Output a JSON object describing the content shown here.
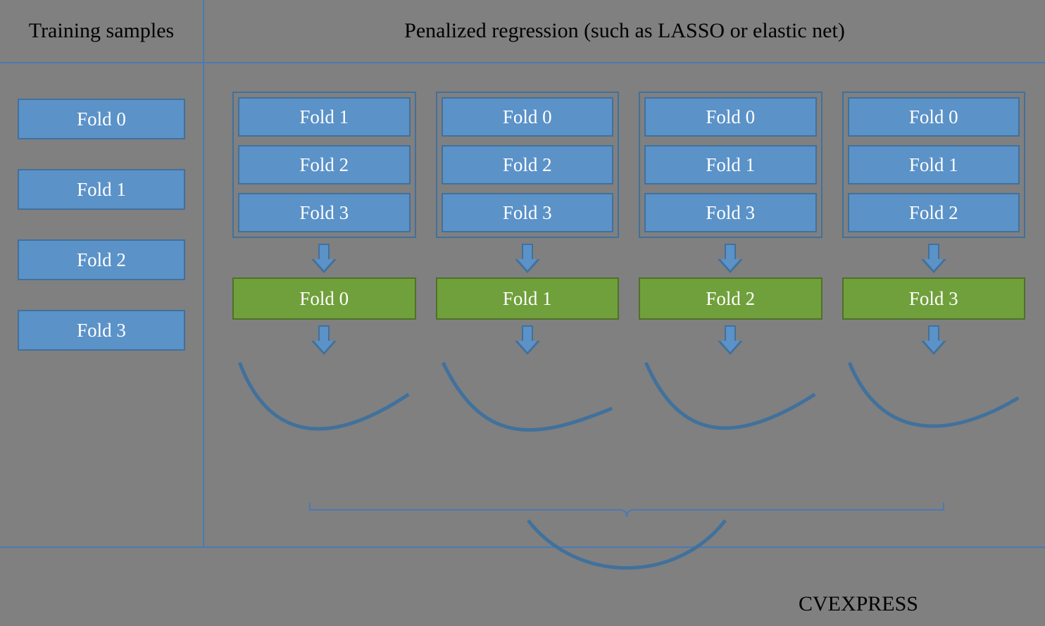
{
  "header": {
    "left": "Training samples",
    "right": "Penalized regression (such as LASSO or elastic net)"
  },
  "left_folds": [
    "Fold 0",
    "Fold 1",
    "Fold 2",
    "Fold 3"
  ],
  "cv_columns": [
    {
      "train": [
        "Fold 1",
        "Fold 2",
        "Fold 3"
      ],
      "test": "Fold 0"
    },
    {
      "train": [
        "Fold 0",
        "Fold 2",
        "Fold 3"
      ],
      "test": "Fold 1"
    },
    {
      "train": [
        "Fold 0",
        "Fold 1",
        "Fold 3"
      ],
      "test": "Fold 2"
    },
    {
      "train": [
        "Fold 0",
        "Fold 1",
        "Fold 2"
      ],
      "test": "Fold 3"
    }
  ],
  "bottom_label": "CVEXPRESS"
}
